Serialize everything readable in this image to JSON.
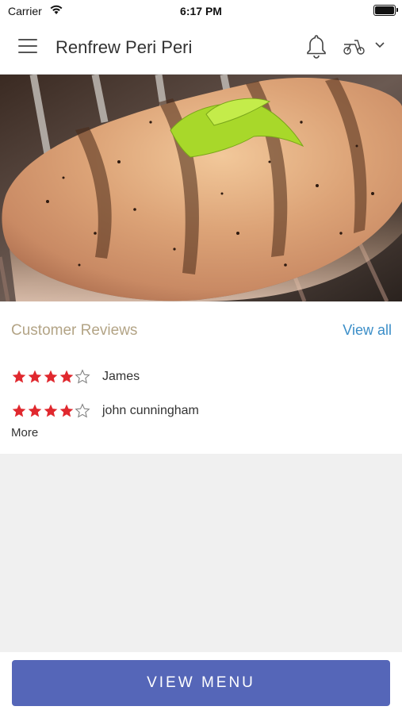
{
  "status_bar": {
    "carrier": "Carrier",
    "time": "6:17 PM"
  },
  "header": {
    "title": "Renfrew Peri Peri"
  },
  "hero": {
    "image": "grilled-chicken-breast-photo"
  },
  "reviews": {
    "title": "Customer Reviews",
    "view_all_label": "View all",
    "items": [
      {
        "rating": 4,
        "max": 5,
        "name": "James"
      },
      {
        "rating": 4,
        "max": 5,
        "name": "john cunningham"
      }
    ],
    "more_label": "More"
  },
  "footer": {
    "view_menu_label": "VIEW MENU"
  },
  "colors": {
    "accent": "#5566b8",
    "star_filled": "#e0282e",
    "link": "#3b8ec8",
    "section_title": "#b3a486"
  }
}
